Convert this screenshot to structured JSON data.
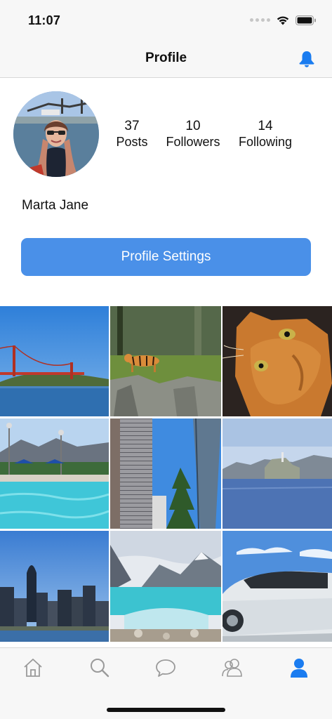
{
  "status_bar": {
    "time": "11:07"
  },
  "nav": {
    "title": "Profile",
    "bell_icon": "bell-icon"
  },
  "profile": {
    "name": "Marta Jane",
    "stats": [
      {
        "value": "37",
        "label": "Posts"
      },
      {
        "value": "10",
        "label": "Followers"
      },
      {
        "value": "14",
        "label": "Following"
      }
    ],
    "settings_label": "Profile Settings"
  },
  "photos": [
    "golden-gate-bridge",
    "tiger-zoo",
    "orange-cat",
    "pool-mountains",
    "skyscraper-trees",
    "alcatraz-bay",
    "city-skyline",
    "mountain-lake",
    "white-car"
  ],
  "tabs": [
    {
      "name": "home",
      "icon": "home-icon",
      "active": false
    },
    {
      "name": "search",
      "icon": "search-icon",
      "active": false
    },
    {
      "name": "chat",
      "icon": "chat-bubble-icon",
      "active": false
    },
    {
      "name": "people",
      "icon": "people-icon",
      "active": false
    },
    {
      "name": "profile",
      "icon": "person-icon",
      "active": true
    }
  ],
  "colors": {
    "accent": "#4a90e8",
    "tab_active": "#1a7cf0",
    "tab_inactive": "#9a9a9a",
    "bar_background": "#f7f7f7"
  }
}
